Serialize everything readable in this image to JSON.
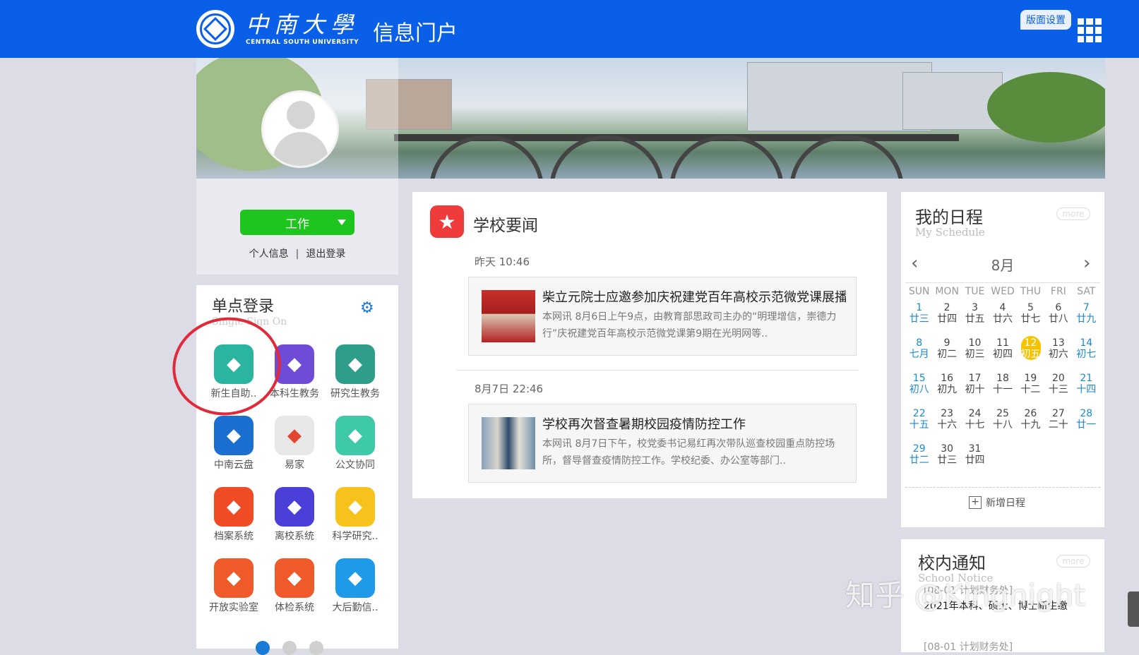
{
  "header": {
    "university_cn": "中南大學",
    "university_en": "CENTRAL SOUTH UNIVERSITY",
    "portal_title": "信息门户",
    "layout_button": "版面设置",
    "apps_icon": "grid-icon"
  },
  "user": {
    "work_button": "工作",
    "profile_link": "个人信息",
    "separator": "|",
    "logout_link": "退出登录"
  },
  "sso": {
    "title": "单点登录",
    "subtitle": "Single Sign On",
    "settings_icon": "gear-icon",
    "apps": [
      {
        "label": "新生自助..",
        "color": "#2bb5a0",
        "icon": "layers-icon"
      },
      {
        "label": "本科生教务",
        "color": "#6f4bd8",
        "icon": "student-icon"
      },
      {
        "label": "研究生教务",
        "color": "#2e9e8a",
        "icon": "graduation-cap-icon"
      },
      {
        "label": "中南云盘",
        "color": "#1a6fd0",
        "icon": "cloud-icon"
      },
      {
        "label": "易家",
        "color": "#e8e8e8",
        "icon": "yijia-icon"
      },
      {
        "label": "公文协同",
        "color": "#3ec9a8",
        "icon": "documents-icon"
      },
      {
        "label": "档案系统",
        "color": "#ef4b25",
        "icon": "folder-icon"
      },
      {
        "label": "离校系统",
        "color": "#4a3fd8",
        "icon": "monitor-icon"
      },
      {
        "label": "科学研究..",
        "color": "#f7c21b",
        "icon": "dna-icon"
      },
      {
        "label": "开放实验室",
        "color": "#ef5a2a",
        "icon": "flask-icon"
      },
      {
        "label": "体检系统",
        "color": "#ef5a2a",
        "icon": "medical-icon"
      },
      {
        "label": "大后勤信..",
        "color": "#1f9ae8",
        "icon": "settings-icon"
      }
    ],
    "pages": [
      1,
      2,
      3
    ]
  },
  "news": {
    "title": "学校要闻",
    "items": [
      {
        "time": "昨天 10:46",
        "headline": "柴立元院士应邀参加庆祝建党百年高校示范微党课展播",
        "summary": "本网讯 8月6日上午9点，由教育部思政司主办的“明理增信，崇德力行”庆祝建党百年高校示范微党课第9期在光明网等.."
      },
      {
        "time": "8月7日 22:46",
        "headline": "学校再次督查暑期校园疫情防控工作",
        "summary": "本网讯 8月7日下午，校党委书记易红再次带队巡查校园重点防控场所，督导督查疫情防控工作。学校纪委、办公室等部门.."
      }
    ]
  },
  "schedule": {
    "title": "我的日程",
    "subtitle": "My Schedule",
    "more": "more",
    "month": "8月",
    "weekdays": [
      "SUN",
      "MON",
      "TUE",
      "WED",
      "THU",
      "FRI",
      "SAT"
    ],
    "today": "12",
    "days": [
      {
        "d": "1",
        "l": "廿三"
      },
      {
        "d": "2",
        "l": "廿四"
      },
      {
        "d": "3",
        "l": "廿五"
      },
      {
        "d": "4",
        "l": "廿六"
      },
      {
        "d": "5",
        "l": "廿七"
      },
      {
        "d": "6",
        "l": "廿八"
      },
      {
        "d": "7",
        "l": "廿九"
      },
      {
        "d": "8",
        "l": "七月"
      },
      {
        "d": "9",
        "l": "初二"
      },
      {
        "d": "10",
        "l": "初三"
      },
      {
        "d": "11",
        "l": "初四"
      },
      {
        "d": "12",
        "l": "初五"
      },
      {
        "d": "13",
        "l": "初六"
      },
      {
        "d": "14",
        "l": "初七"
      },
      {
        "d": "15",
        "l": "初八"
      },
      {
        "d": "16",
        "l": "初九"
      },
      {
        "d": "17",
        "l": "初十"
      },
      {
        "d": "18",
        "l": "十一"
      },
      {
        "d": "19",
        "l": "十二"
      },
      {
        "d": "20",
        "l": "十三"
      },
      {
        "d": "21",
        "l": "十四"
      },
      {
        "d": "22",
        "l": "十五"
      },
      {
        "d": "23",
        "l": "十六"
      },
      {
        "d": "24",
        "l": "十七"
      },
      {
        "d": "25",
        "l": "十八"
      },
      {
        "d": "26",
        "l": "十九"
      },
      {
        "d": "27",
        "l": "二十"
      },
      {
        "d": "28",
        "l": "廿一"
      },
      {
        "d": "29",
        "l": "廿二"
      },
      {
        "d": "30",
        "l": "廿三"
      },
      {
        "d": "31",
        "l": "廿四"
      }
    ],
    "add_label": "新增日程"
  },
  "notice": {
    "title": "校内通知",
    "subtitle": "School Notice",
    "more": "more",
    "items": [
      "[08-01 计划财务处]",
      "2021年本科、硕士、博士新生缴",
      "[08-01 计划财务处]"
    ]
  },
  "watermark": "知乎 @Kingnight"
}
